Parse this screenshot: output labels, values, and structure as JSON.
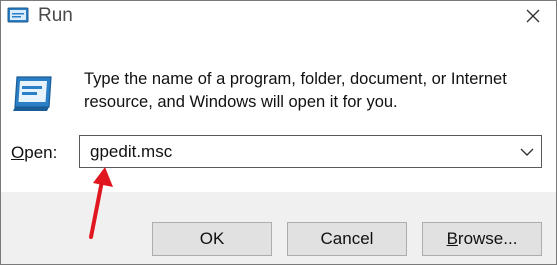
{
  "window": {
    "title": "Run",
    "icon": "run-icon",
    "close_icon": "close-icon"
  },
  "body": {
    "icon": "run-program-icon",
    "description": "Type the name of a program, folder, document, or Internet resource, and Windows will open it for you.",
    "open_label_mnemonic": "O",
    "open_label_rest": "pen:",
    "open_value": "gpedit.msc",
    "dropdown_icon": "chevron-down-icon"
  },
  "buttons": {
    "ok": "OK",
    "cancel": "Cancel",
    "browse_mnemonic": "B",
    "browse_rest": "rowse..."
  },
  "annotation": {
    "icon": "red-arrow-icon",
    "color": "#e0171f"
  },
  "colors": {
    "footer": "#f0f0f0",
    "button_bg": "#e1e1e1",
    "button_border": "#adadad",
    "icon_blue": "#2b7fc6"
  }
}
